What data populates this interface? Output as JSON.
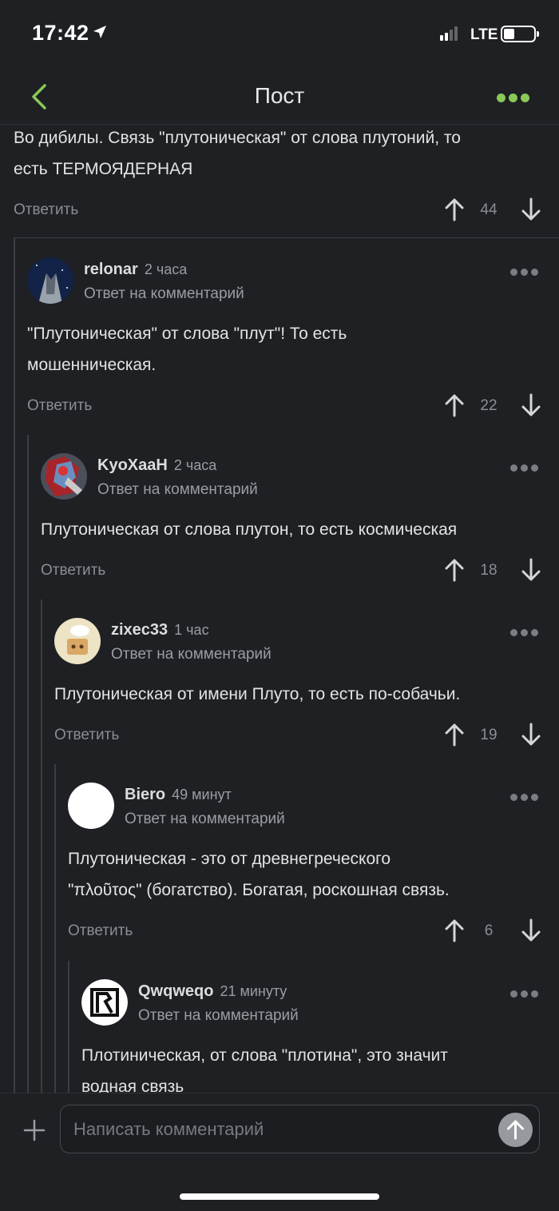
{
  "status_bar": {
    "time": "17:42",
    "network": "LTE"
  },
  "navbar": {
    "title": "Пост"
  },
  "top_comment": {
    "text_line1": "Во дибилы. Связь \"плутоническая\" от слова плутоний, то",
    "text_line2": "есть ТЕРМОЯДЕРНАЯ",
    "reply_label": "Ответить",
    "votes": "44"
  },
  "comments": [
    {
      "username": "relonar",
      "time_ago": "2 часа",
      "reply_to": "Ответ на комментарий",
      "text_line1": "\"Плутоническая\" от слова \"плут\"! То есть",
      "text_line2": "мошенническая.",
      "reply_label": "Ответить",
      "votes": "22"
    },
    {
      "username": "KyoXaaH",
      "time_ago": "2 часа",
      "reply_to": "Ответ на комментарий",
      "text_line1": "Плутоническая от слова плутон,  то есть космическая",
      "text_line2": "",
      "reply_label": "Ответить",
      "votes": "18"
    },
    {
      "username": "zixec33",
      "time_ago": "1 час",
      "reply_to": "Ответ на комментарий",
      "text_line1": "Плутоническая от имени Плуто, то есть по-собачьи.",
      "text_line2": "",
      "reply_label": "Ответить",
      "votes": "19"
    },
    {
      "username": "Biero",
      "time_ago": "49 минут",
      "reply_to": "Ответ на комментарий",
      "text_line1": "Плутоническая - это от древнегреческого",
      "text_line2": "\"πλοῦτος\" (богатство). Богатая, роскошная связь.",
      "reply_label": "Ответить",
      "votes": "6"
    },
    {
      "username": "Qwqweqo",
      "time_ago": "21 минуту",
      "reply_to": "Ответ на комментарий",
      "text_line1": "Плотиническая, от слова \"плотина\", это значит",
      "text_line2": "водная связь",
      "reply_label": "",
      "votes": ""
    }
  ],
  "composer": {
    "placeholder": "Написать комментарий"
  },
  "colors": {
    "accent": "#8ac858",
    "background": "#1e2023",
    "muted": "#8a8d92"
  }
}
